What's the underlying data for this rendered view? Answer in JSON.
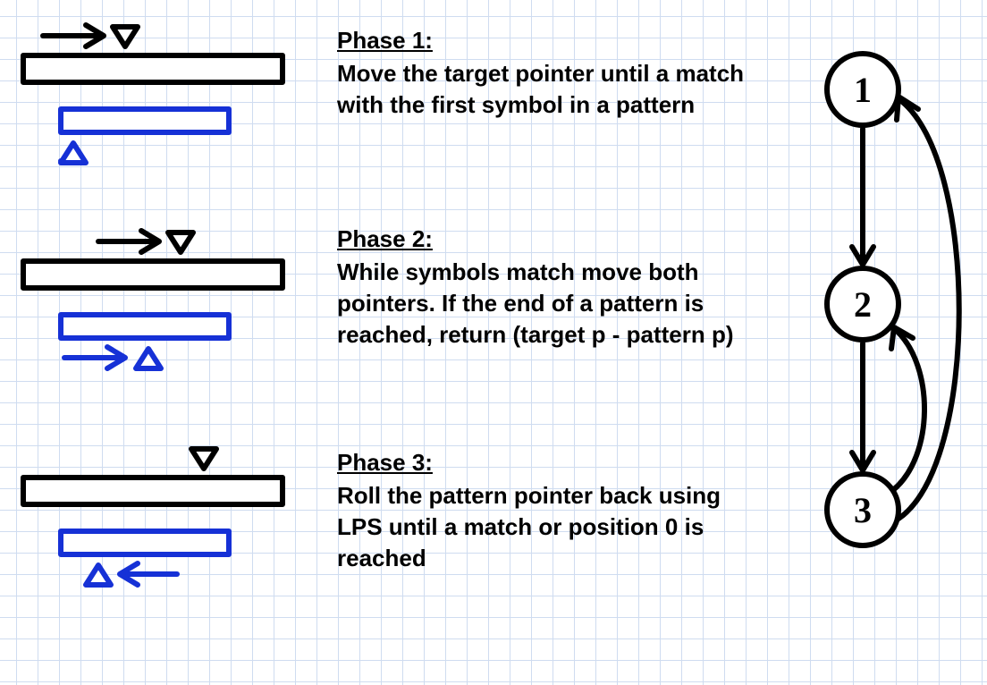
{
  "phases": [
    {
      "title": "Phase 1:",
      "body": "Move the target pointer until a match with the first symbol in a pattern"
    },
    {
      "title": "Phase 2:",
      "body": "While symbols match move both pointers. If the end of a pattern is reached, return (target p - pattern p)"
    },
    {
      "title": "Phase 3:",
      "body": "Roll the pattern pointer back using LPS until a match or position 0 is reached"
    }
  ],
  "nodes": [
    "1",
    "2",
    "3"
  ],
  "colors": {
    "black": "#000000",
    "blue": "#1631d6"
  }
}
